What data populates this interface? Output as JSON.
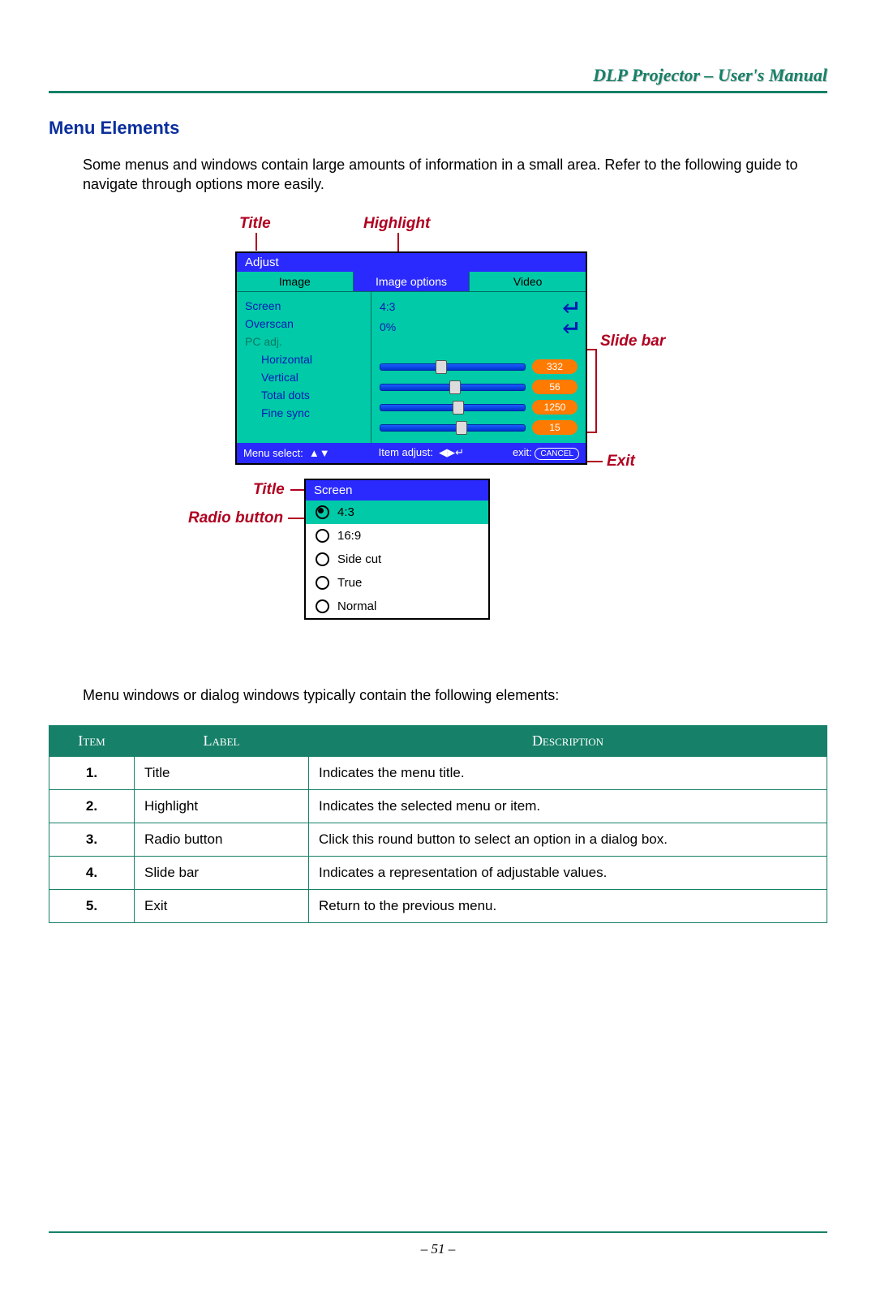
{
  "doc_header": "DLP Projector – User's Manual",
  "section_title": "Menu Elements",
  "intro": "Some menus and windows contain large amounts of information in a small area. Refer to the following guide to navigate through options more easily.",
  "intro2": "Menu windows or dialog windows typically contain the following elements:",
  "callouts": {
    "title": "Title",
    "highlight": "Highlight",
    "slidebar": "Slide bar",
    "exit": "Exit",
    "title2": "Title",
    "radio": "Radio button"
  },
  "osd": {
    "title": "Adjust",
    "tabs": [
      "Image",
      "Image options",
      "Video"
    ],
    "labels": [
      "Screen",
      "Overscan",
      "PC adj.",
      "Horizontal",
      "Vertical",
      "Total dots",
      "Fine sync"
    ],
    "values": {
      "screen": "4:3",
      "overscan": "0%"
    },
    "sliders": [
      {
        "label": "Horizontal",
        "value": 332,
        "pos": 38
      },
      {
        "label": "Vertical",
        "value": 56,
        "pos": 48
      },
      {
        "label": "Total dots",
        "value": 1250,
        "pos": 50
      },
      {
        "label": "Fine sync",
        "value": 15,
        "pos": 52
      }
    ],
    "footer": {
      "menu_select": "Menu select:",
      "item_adjust": "Item adjust:",
      "exit": "exit:",
      "cancel": "CANCEL"
    }
  },
  "submenu": {
    "title": "Screen",
    "items": [
      "4:3",
      "16:9",
      "Side cut",
      "True",
      "Normal"
    ],
    "selected_index": 0
  },
  "table": {
    "headers": [
      "Item",
      "Label",
      "Description"
    ],
    "rows": [
      {
        "n": "1.",
        "label": "Title",
        "desc": "Indicates the menu title."
      },
      {
        "n": "2.",
        "label": "Highlight",
        "desc": "Indicates the selected menu or item."
      },
      {
        "n": "3.",
        "label": "Radio button",
        "desc": "Click this round button to select an option in a dialog box."
      },
      {
        "n": "4.",
        "label": "Slide bar",
        "desc": "Indicates a representation of adjustable values."
      },
      {
        "n": "5.",
        "label": "Exit",
        "desc": "Return to the previous menu."
      }
    ]
  },
  "page_number": "– 51 –"
}
